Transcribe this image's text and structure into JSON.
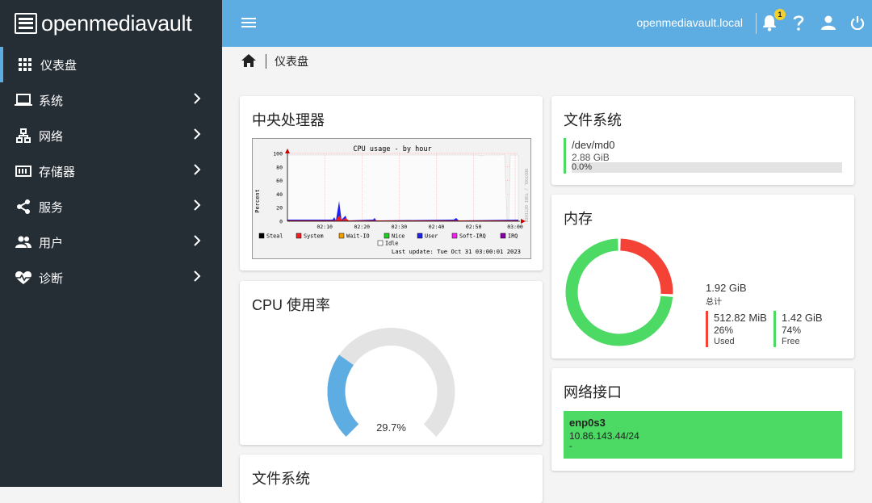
{
  "app": {
    "logo_text": "openmediavault"
  },
  "topbar": {
    "hostname": "openmediavault.local",
    "notification_count": "1"
  },
  "breadcrumb": {
    "current": "仪表盘"
  },
  "sidebar": {
    "items": [
      {
        "label": "仪表盘",
        "icon": "apps-grid-icon",
        "active": true
      },
      {
        "label": "系统",
        "icon": "laptop-icon"
      },
      {
        "label": "网络",
        "icon": "network-icon"
      },
      {
        "label": "存储器",
        "icon": "storage-icon"
      },
      {
        "label": "服务",
        "icon": "share-icon"
      },
      {
        "label": "用户",
        "icon": "users-icon"
      },
      {
        "label": "诊断",
        "icon": "heart-pulse-icon"
      }
    ]
  },
  "cpu_chart": {
    "title": "中央处理器",
    "image_title": "CPU usage - by hour",
    "ylabel": "Percent",
    "yticks": [
      "100",
      "80",
      "60",
      "40",
      "20",
      "0"
    ],
    "xticks": [
      "02:10",
      "02:20",
      "02:30",
      "02:40",
      "02:50",
      "03:00"
    ],
    "side_label": "RRDTOOL / TOBI OETIKER",
    "legend": [
      "Steal",
      "System",
      "Wait-IO",
      "Nice",
      "User",
      "Soft-IRQ",
      "IRQ",
      "Idle"
    ],
    "last_update": "Last update: Tue Oct 31 03:00:01 2023",
    "colors": {
      "steal": "#000000",
      "system": "#ee2222",
      "waitio": "#f0a000",
      "nice": "#22cc22",
      "user": "#2222ee",
      "softirq": "#ee22ee",
      "irq": "#8800aa",
      "idle": "#ffffff"
    }
  },
  "cpu_usage": {
    "title": "CPU 使用率",
    "value": 29.7,
    "value_label": "29.7%",
    "color": "#5dade2",
    "track": "#e3e3e3"
  },
  "filesystem_top": {
    "title": "文件系统",
    "device": "/dev/md0",
    "size": "2.88 GiB",
    "percent_label": "0.0%",
    "percent": 0.0,
    "color": "#4cd964"
  },
  "memory": {
    "title": "内存",
    "total": "1.92 GiB",
    "total_label": "总计",
    "used": "512.82 MiB",
    "used_pct": "26%",
    "used_label": "Used",
    "free": "1.42 GiB",
    "free_pct": "74%",
    "free_label": "Free",
    "used_fraction": 0.26,
    "used_color": "#f44336",
    "free_color": "#4cd964"
  },
  "network": {
    "title": "网络接口",
    "iface": "enp0s3",
    "address": "10.86.143.44/24",
    "extra": "-",
    "color": "#4cd964"
  },
  "filesystem_bottom": {
    "title": "文件系统"
  }
}
